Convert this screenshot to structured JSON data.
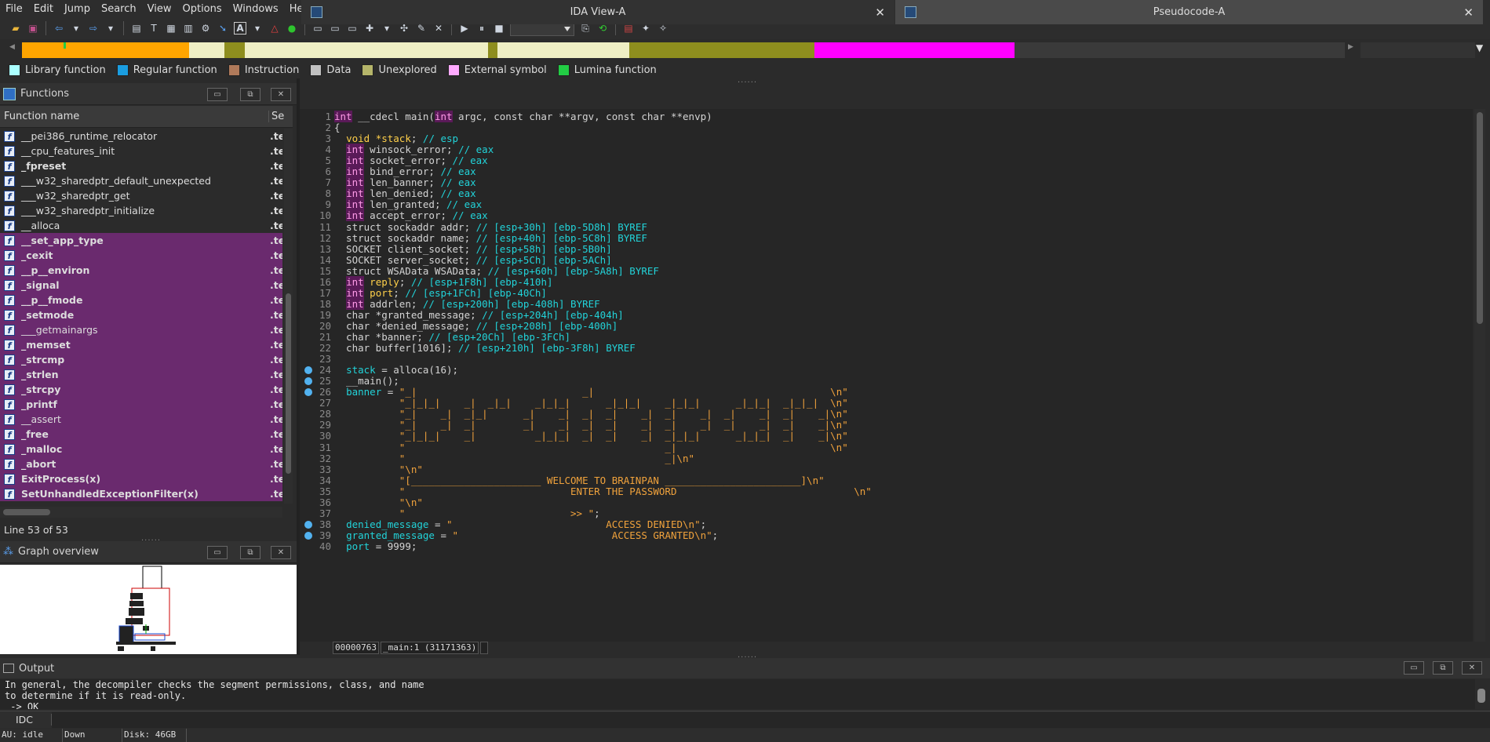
{
  "menu": [
    "File",
    "Edit",
    "Jump",
    "Search",
    "View",
    "Options",
    "Windows",
    "Help"
  ],
  "legend": [
    {
      "label": "Library function",
      "color": "#aaffff"
    },
    {
      "label": "Regular function",
      "color": "#1a9de0"
    },
    {
      "label": "Instruction",
      "color": "#b07a5a"
    },
    {
      "label": "Data",
      "color": "#c0c0c0"
    },
    {
      "label": "Unexplored",
      "color": "#b5b56a"
    },
    {
      "label": "External symbol",
      "color": "#ffaaff"
    },
    {
      "label": "Lumina function",
      "color": "#22cc44"
    }
  ],
  "functions_panel": {
    "title": "Functions",
    "col_name": "Function name",
    "col_seg": "Se",
    "line_count": "Line 53 of 53",
    "rows": [
      {
        "name": "__pei386_runtime_relocator",
        "seg": ".te",
        "purple": false,
        "bold": false
      },
      {
        "name": "__cpu_features_init",
        "seg": ".te",
        "purple": false,
        "bold": false
      },
      {
        "name": "_fpreset",
        "seg": ".te",
        "purple": false,
        "bold": true
      },
      {
        "name": "___w32_sharedptr_default_unexpected",
        "seg": ".te",
        "purple": false,
        "bold": false
      },
      {
        "name": "___w32_sharedptr_get",
        "seg": ".te",
        "purple": false,
        "bold": false
      },
      {
        "name": "___w32_sharedptr_initialize",
        "seg": ".te",
        "purple": false,
        "bold": false
      },
      {
        "name": "__alloca",
        "seg": ".te",
        "purple": false,
        "bold": false
      },
      {
        "name": "__set_app_type",
        "seg": ".te",
        "purple": true,
        "bold": true
      },
      {
        "name": "_cexit",
        "seg": ".te",
        "purple": true,
        "bold": true
      },
      {
        "name": "__p__environ",
        "seg": ".te",
        "purple": true,
        "bold": true
      },
      {
        "name": "_signal",
        "seg": ".te",
        "purple": true,
        "bold": true
      },
      {
        "name": "__p__fmode",
        "seg": ".te",
        "purple": true,
        "bold": true
      },
      {
        "name": "_setmode",
        "seg": ".te",
        "purple": true,
        "bold": true
      },
      {
        "name": "___getmainargs",
        "seg": ".te",
        "purple": true,
        "bold": false
      },
      {
        "name": "_memset",
        "seg": ".te",
        "purple": true,
        "bold": true
      },
      {
        "name": "_strcmp",
        "seg": ".te",
        "purple": true,
        "bold": true
      },
      {
        "name": "_strlen",
        "seg": ".te",
        "purple": true,
        "bold": true
      },
      {
        "name": "_strcpy",
        "seg": ".te",
        "purple": true,
        "bold": true
      },
      {
        "name": "_printf",
        "seg": ".te",
        "purple": true,
        "bold": true
      },
      {
        "name": "__assert",
        "seg": ".te",
        "purple": true,
        "bold": false
      },
      {
        "name": "_free",
        "seg": ".te",
        "purple": true,
        "bold": true
      },
      {
        "name": "_malloc",
        "seg": ".te",
        "purple": true,
        "bold": true
      },
      {
        "name": "_abort",
        "seg": ".te",
        "purple": true,
        "bold": true
      },
      {
        "name": "ExitProcess(x)",
        "seg": ".te",
        "purple": true,
        "bold": true
      },
      {
        "name": "SetUnhandledExceptionFilter(x)",
        "seg": ".te",
        "purple": true,
        "bold": true
      }
    ]
  },
  "graph_overview": {
    "title": "Graph overview"
  },
  "tabs": {
    "ida_view": "IDA View-A",
    "pseudocode": "Pseudocode-A"
  },
  "code_lines": [
    {
      "n": "1",
      "bp": false,
      "html": "<span class=\"kw\">int</span> __cdecl main(<span class=\"kw\">int</span> argc, const char **argv, const char **envp)"
    },
    {
      "n": "2",
      "bp": false,
      "html": "{"
    },
    {
      "n": "3",
      "bp": false,
      "html": "  <span class=\"ty\">void</span> <span class=\"ty\">*stack</span>; <span class=\"cm\">// esp</span>"
    },
    {
      "n": "4",
      "bp": false,
      "html": "  <span class=\"kw\">int</span> winsock_error; <span class=\"cm\">// eax</span>"
    },
    {
      "n": "5",
      "bp": false,
      "html": "  <span class=\"kw\">int</span> socket_error; <span class=\"cm\">// eax</span>"
    },
    {
      "n": "6",
      "bp": false,
      "html": "  <span class=\"kw\">int</span> bind_error; <span class=\"cm\">// eax</span>"
    },
    {
      "n": "7",
      "bp": false,
      "html": "  <span class=\"kw\">int</span> len_banner; <span class=\"cm\">// eax</span>"
    },
    {
      "n": "8",
      "bp": false,
      "html": "  <span class=\"kw\">int</span> len_denied; <span class=\"cm\">// eax</span>"
    },
    {
      "n": "9",
      "bp": false,
      "html": "  <span class=\"kw\">int</span> len_granted; <span class=\"cm\">// eax</span>"
    },
    {
      "n": "10",
      "bp": false,
      "html": "  <span class=\"kw\">int</span> accept_error; <span class=\"cm\">// eax</span>"
    },
    {
      "n": "11",
      "bp": false,
      "html": "  struct sockaddr addr; <span class=\"cm\">// [esp+30h] [ebp-5D8h] BYREF</span>"
    },
    {
      "n": "12",
      "bp": false,
      "html": "  struct sockaddr name; <span class=\"cm\">// [esp+40h] [ebp-5C8h] BYREF</span>"
    },
    {
      "n": "13",
      "bp": false,
      "html": "  SOCKET client_socket; <span class=\"cm\">// [esp+58h] [ebp-5B0h]</span>"
    },
    {
      "n": "14",
      "bp": false,
      "html": "  SOCKET server_socket; <span class=\"cm\">// [esp+5Ch] [ebp-5ACh]</span>"
    },
    {
      "n": "15",
      "bp": false,
      "html": "  struct WSAData WSAData; <span class=\"cm\">// [esp+60h] [ebp-5A8h] BYREF</span>"
    },
    {
      "n": "16",
      "bp": false,
      "html": "  <span class=\"kw\">int</span> <span class=\"ty\">reply</span>; <span class=\"cm\">// [esp+1F8h] [ebp-410h]</span>"
    },
    {
      "n": "17",
      "bp": false,
      "html": "  <span class=\"kw\">int</span> <span class=\"ty\">port</span>; <span class=\"cm\">// [esp+1FCh] [ebp-40Ch]</span>"
    },
    {
      "n": "18",
      "bp": false,
      "html": "  <span class=\"kw\">int</span> addrlen; <span class=\"cm\">// [esp+200h] [ebp-408h] BYREF</span>"
    },
    {
      "n": "19",
      "bp": false,
      "html": "  char *granted_message; <span class=\"cm\">// [esp+204h] [ebp-404h]</span>"
    },
    {
      "n": "20",
      "bp": false,
      "html": "  char *denied_message; <span class=\"cm\">// [esp+208h] [ebp-400h]</span>"
    },
    {
      "n": "21",
      "bp": false,
      "html": "  char *banner; <span class=\"cm\">// [esp+20Ch] [ebp-3FCh]</span>"
    },
    {
      "n": "22",
      "bp": false,
      "html": "  char buffer[1016]; <span class=\"cm\">// [esp+210h] [ebp-3F8h] BYREF</span>"
    },
    {
      "n": "23",
      "bp": false,
      "html": ""
    },
    {
      "n": "24",
      "bp": true,
      "html": "  <span class=\"id\">stack</span> = alloca(16);"
    },
    {
      "n": "25",
      "bp": true,
      "html": "  __main();"
    },
    {
      "n": "26",
      "bp": true,
      "html": "  <span class=\"id\">banner</span> = <span class=\"st\">\"_|                            _|                                        \\n\"</span>"
    },
    {
      "n": "27",
      "bp": false,
      "html": "<span class=\"st\">           \"_|_|_|    _|  _|_|    _|_|_|      _|_|_|    _|_|_|      _|_|_|  _|_|_|  \\n\"</span>"
    },
    {
      "n": "28",
      "bp": false,
      "html": "<span class=\"st\">           \"_|    _|  _|_|      _|    _|  _|  _|    _|  _|    _|  _|    _|  _|    _|\\n\"</span>"
    },
    {
      "n": "29",
      "bp": false,
      "html": "<span class=\"st\">           \"_|    _|  _|        _|    _|  _|  _|    _|  _|    _|  _|    _|  _|    _|\\n\"</span>"
    },
    {
      "n": "30",
      "bp": false,
      "html": "<span class=\"st\">           \"_|_|_|    _|          _|_|_|  _|  _|    _|  _|_|_|      _|_|_|  _|    _|\\n\"</span>"
    },
    {
      "n": "31",
      "bp": false,
      "html": "<span class=\"st\">           \"                                            _|                          \\n\"</span>"
    },
    {
      "n": "32",
      "bp": false,
      "html": "<span class=\"st\">           \"                                            _|\\n\"</span>"
    },
    {
      "n": "33",
      "bp": false,
      "html": "<span class=\"st\">           \"\\n\"</span>"
    },
    {
      "n": "34",
      "bp": false,
      "html": "<span class=\"st\">           \"[______________________ WELCOME TO BRAINPAN _______________________]\\n\"</span>"
    },
    {
      "n": "35",
      "bp": false,
      "html": "<span class=\"st\">           \"                            ENTER THE PASSWORD                              \\n\"</span>"
    },
    {
      "n": "36",
      "bp": false,
      "html": "<span class=\"st\">           \"\\n\"</span>"
    },
    {
      "n": "37",
      "bp": false,
      "html": "<span class=\"st\">           \"                            &gt;&gt; \"</span>;"
    },
    {
      "n": "38",
      "bp": true,
      "html": "  <span class=\"id\">denied_message</span> = <span class=\"st\">\"                          ACCESS DENIED\\n\"</span>;"
    },
    {
      "n": "39",
      "bp": true,
      "html": "  <span class=\"id\">granted_message</span> = <span class=\"st\">\"                          ACCESS GRANTED\\n\"</span>;"
    },
    {
      "n": "40",
      "bp": false,
      "html": "  <span class=\"id\">port</span> = 9999;"
    }
  ],
  "code_status": [
    "00000763",
    "_main:1 (31171363)",
    ""
  ],
  "output": {
    "title": "Output",
    "lines": "In general, the decompiler checks the segment permissions, class, and name\nto determine if it is read-only.\n -> OK"
  },
  "idc_label": "IDC",
  "statusbar": [
    "AU:  idle",
    "Down",
    "Disk: 46GB"
  ]
}
